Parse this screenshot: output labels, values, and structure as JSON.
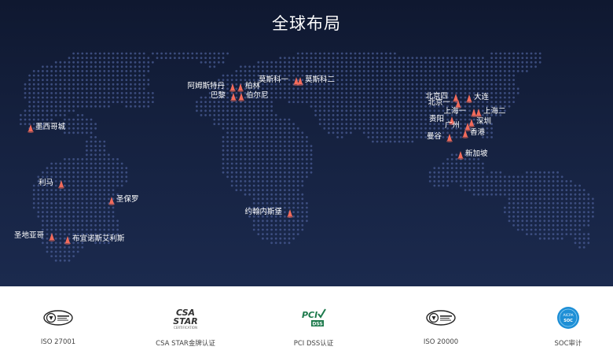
{
  "page": {
    "title": "全球布局"
  },
  "colors": {
    "background": "#15213f",
    "dots": "#4a5c94",
    "pin": "#f26b5b",
    "text": "#ffffff"
  },
  "locations": [
    {
      "name": "墨西哥城"
    },
    {
      "name": "利马"
    },
    {
      "name": "圣保罗"
    },
    {
      "name": "圣地亚哥"
    },
    {
      "name": "布宜诺斯艾利斯"
    },
    {
      "name": "阿姆斯特丹"
    },
    {
      "name": "柏林"
    },
    {
      "name": "巴黎"
    },
    {
      "name": "伯尔尼"
    },
    {
      "name": "莫斯科一"
    },
    {
      "name": "莫斯科二"
    },
    {
      "name": "约翰内斯堡"
    },
    {
      "name": "北京四"
    },
    {
      "name": "大连"
    },
    {
      "name": "北京一"
    },
    {
      "name": "上海一"
    },
    {
      "name": "上海二"
    },
    {
      "name": "贵阳"
    },
    {
      "name": "深圳"
    },
    {
      "name": "广州"
    },
    {
      "name": "香港"
    },
    {
      "name": "曼谷"
    },
    {
      "name": "新加坡"
    }
  ],
  "certifications": [
    {
      "label": "ISO 27001",
      "icon": "bsi-kitemark-icon"
    },
    {
      "label": "CSA STAR金牌认证",
      "icon": "csa-star-logo",
      "logo_text": "CSA",
      "logo_sub": "STAR",
      "logo_small": "CERTIFICATION"
    },
    {
      "label": "PCI DSS认证",
      "icon": "pci-dss-logo",
      "logo_text": "PCI",
      "logo_sub": "DSS"
    },
    {
      "label": "ISO 20000",
      "icon": "bsi-kitemark-icon"
    },
    {
      "label": "SOC审计",
      "icon": "aicpa-soc-logo",
      "logo_text": "AICPA",
      "logo_sub": "SOC"
    }
  ]
}
